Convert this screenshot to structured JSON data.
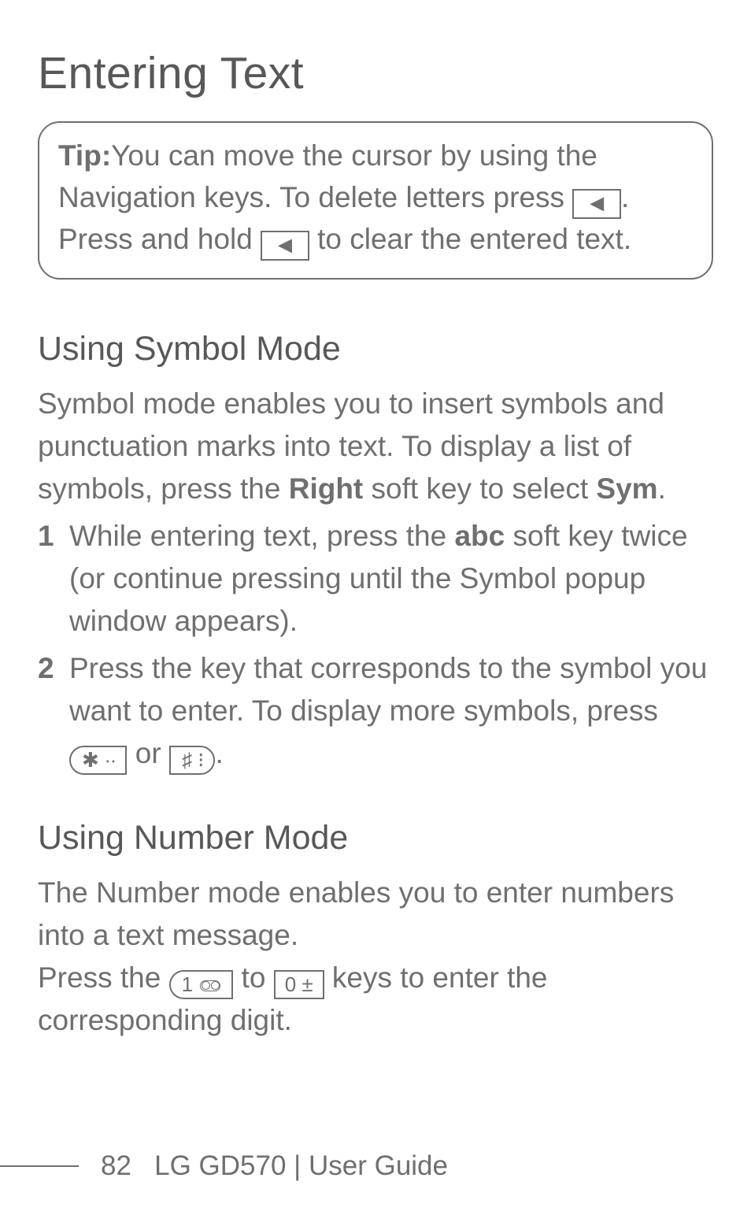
{
  "title": "Entering Text",
  "tip": {
    "label": "Tip:",
    "l1a": "You can move the cursor by using the ",
    "l2a": "Navigation keys. To delete letters press ",
    "key_back1": "◄",
    "l2b": ". ",
    "l3a": "Press and hold ",
    "key_back2": "◄",
    "l3b": " to clear the entered text."
  },
  "symbol": {
    "heading": "Using Symbol Mode",
    "p1a": "Symbol mode enables you to insert symbols and punctuation marks into text. To display a list of symbols, press the ",
    "p1_right": "Right",
    "p1b": " soft key to select ",
    "p1_sym": "Sym",
    "p1c": ".",
    "items": [
      {
        "num": "1",
        "a": "While entering text, press the ",
        "abc": "abc",
        "b": " soft key twice (or continue pressing until the Symbol popup window appears)."
      },
      {
        "num": "2",
        "a": "Press the key that corresponds to the symbol you want to enter. To display more symbols, press ",
        "key_star": "✱ ∙∙",
        "mid": " or ",
        "key_hash": "♯ ⁝",
        "b": "."
      }
    ]
  },
  "number": {
    "heading": "Using Number Mode",
    "p1": "The Number mode enables you to enter numbers into a text message.",
    "p2a": "Press the ",
    "key_one": "1",
    "p2b": " to ",
    "key_zero": "0 ±",
    "p2c": " keys to enter the corresponding digit."
  },
  "footer": {
    "page": "82",
    "label": "LG GD570  |  User Guide"
  }
}
